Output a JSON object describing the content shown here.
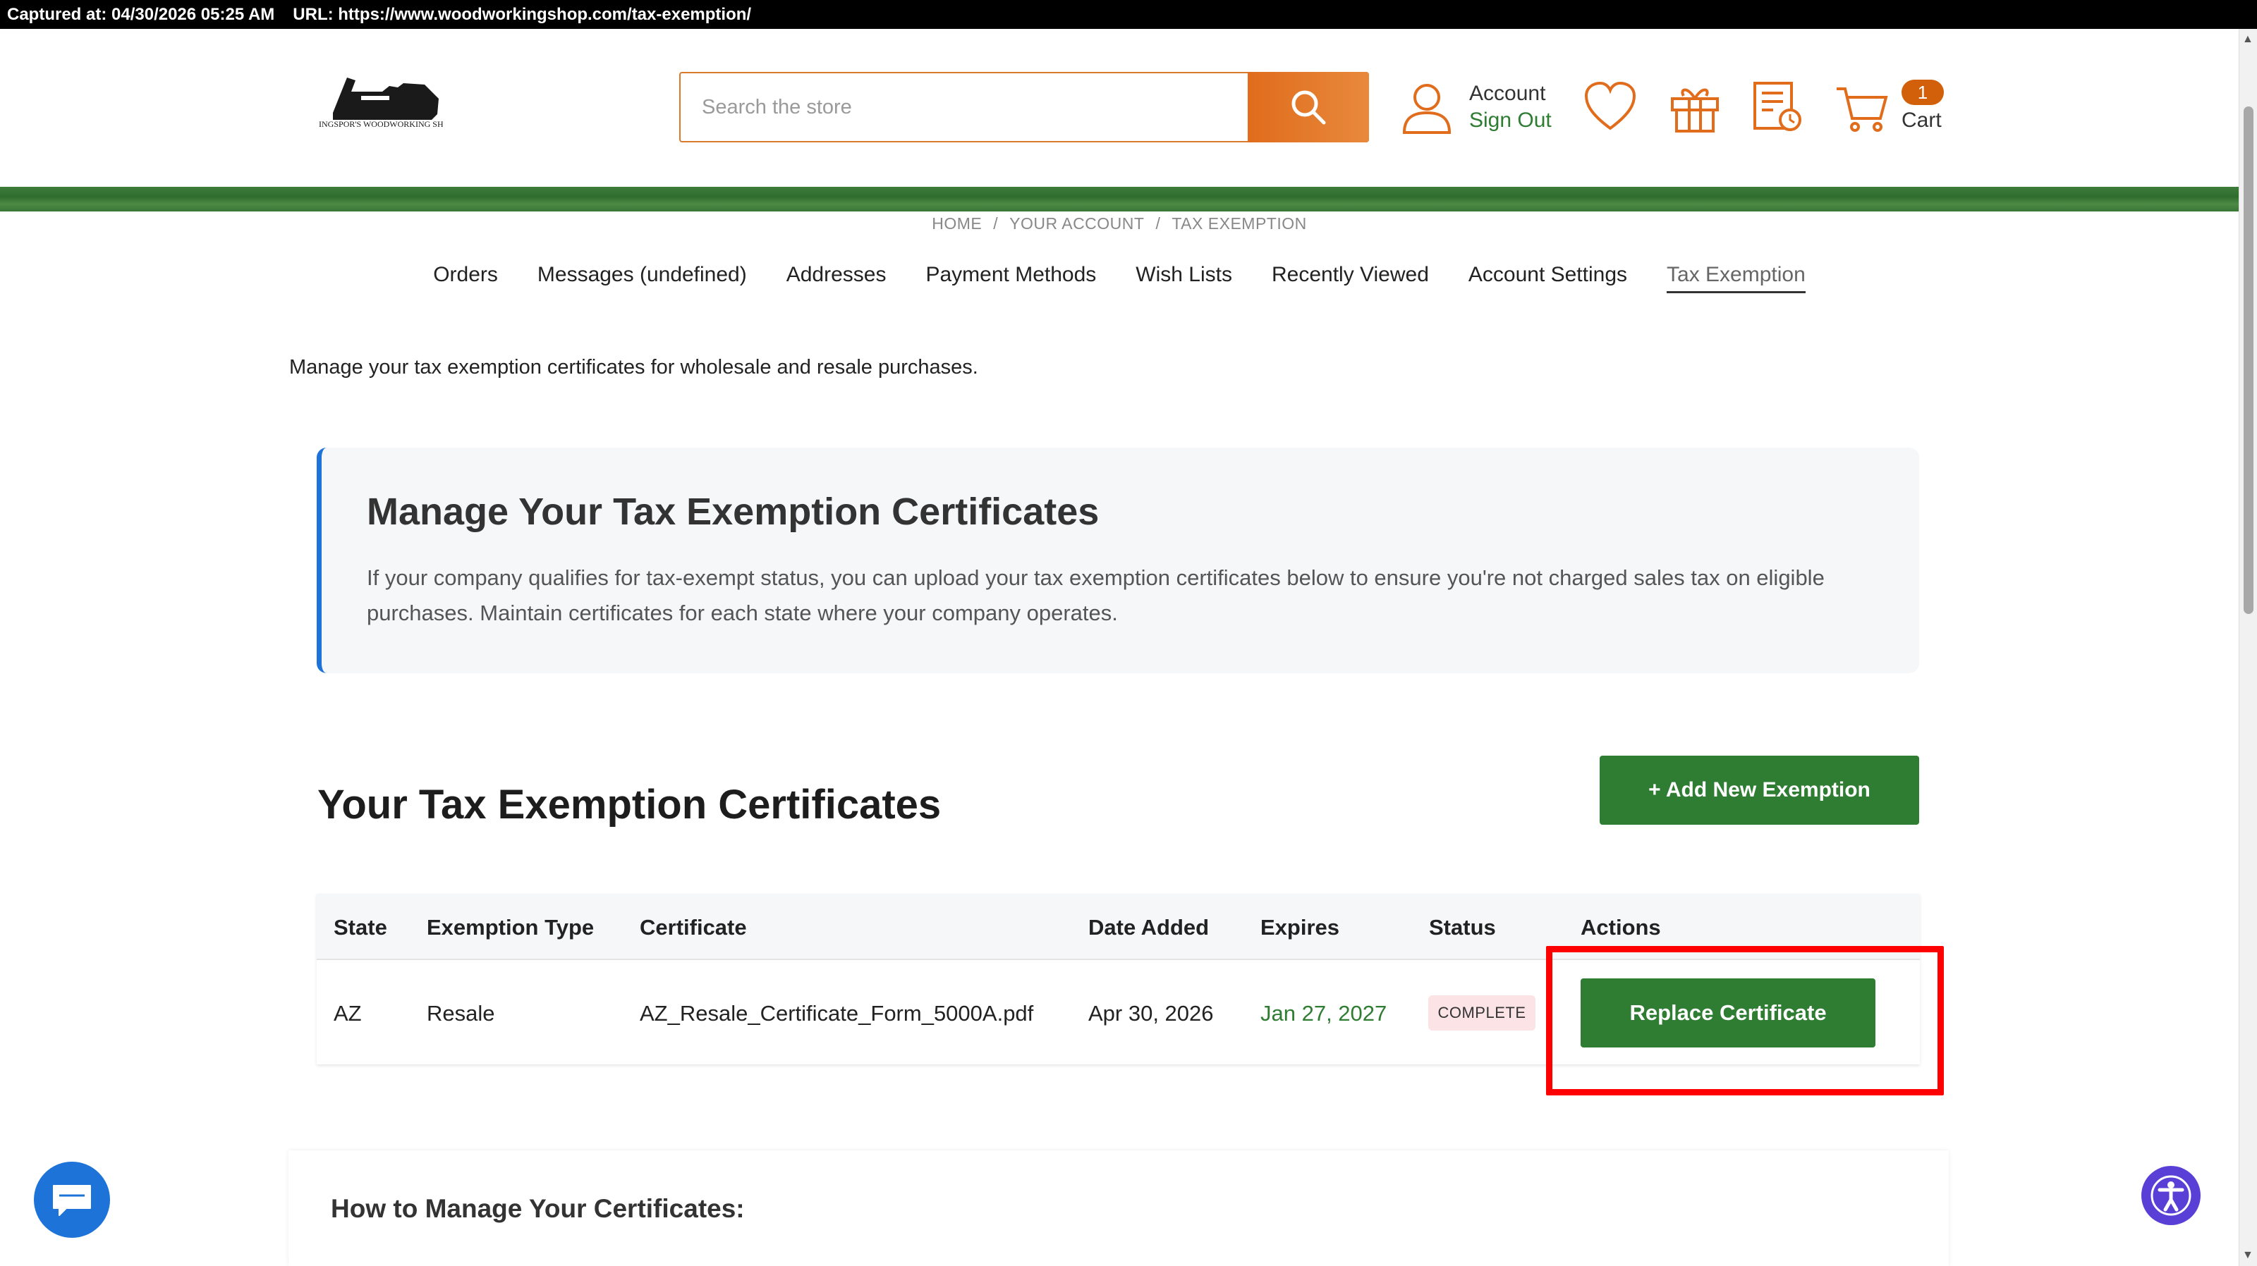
{
  "capture": {
    "captured_at": "Captured at: 04/30/2026 05:25 AM",
    "url": "URL: https://www.woodworkingshop.com/tax-exemption/"
  },
  "header": {
    "logo_text": "KLINGSPOR'S WOODWORKING SHOP",
    "search_placeholder": "Search the store",
    "account_label": "Account",
    "signout_label": "Sign Out",
    "cart_count": "1",
    "cart_label": "Cart"
  },
  "breadcrumb": [
    "HOME",
    "YOUR ACCOUNT",
    "TAX EXEMPTION"
  ],
  "subnav": {
    "orders": "Orders",
    "messages": "Messages (undefined)",
    "addresses": "Addresses",
    "payment": "Payment Methods",
    "wishlists": "Wish Lists",
    "recent": "Recently Viewed",
    "settings": "Account Settings",
    "tax": "Tax Exemption"
  },
  "intro": "Manage your tax exemption certificates for wholesale and resale purchases.",
  "infobox": {
    "title": "Manage Your Tax Exemption Certificates",
    "body": "If your company qualifies for tax-exempt status, you can upload your tax exemption certificates below to ensure you're not charged sales tax on eligible purchases. Maintain certificates for each state where your company operates."
  },
  "certificates": {
    "title": "Your Tax Exemption Certificates",
    "add_label": "+ Add New Exemption",
    "headers": {
      "state": "State",
      "type": "Exemption Type",
      "certificate": "Certificate",
      "added": "Date Added",
      "expires": "Expires",
      "status": "Status",
      "actions": "Actions"
    },
    "row": {
      "state": "AZ",
      "type": "Resale",
      "certificate": "AZ_Resale_Certificate_Form_5000A.pdf",
      "added": "Apr 30, 2026",
      "expires": "Jan 27, 2027",
      "status": "COMPLETE",
      "action": "Replace Certificate"
    }
  },
  "howto": {
    "title": "How to Manage Your Certificates:"
  },
  "colors": {
    "brand_green": "#2e7d32",
    "search_orange": "#e06c1c",
    "accent_blue": "#1e73d8",
    "highlight_red": "#ff0000"
  }
}
